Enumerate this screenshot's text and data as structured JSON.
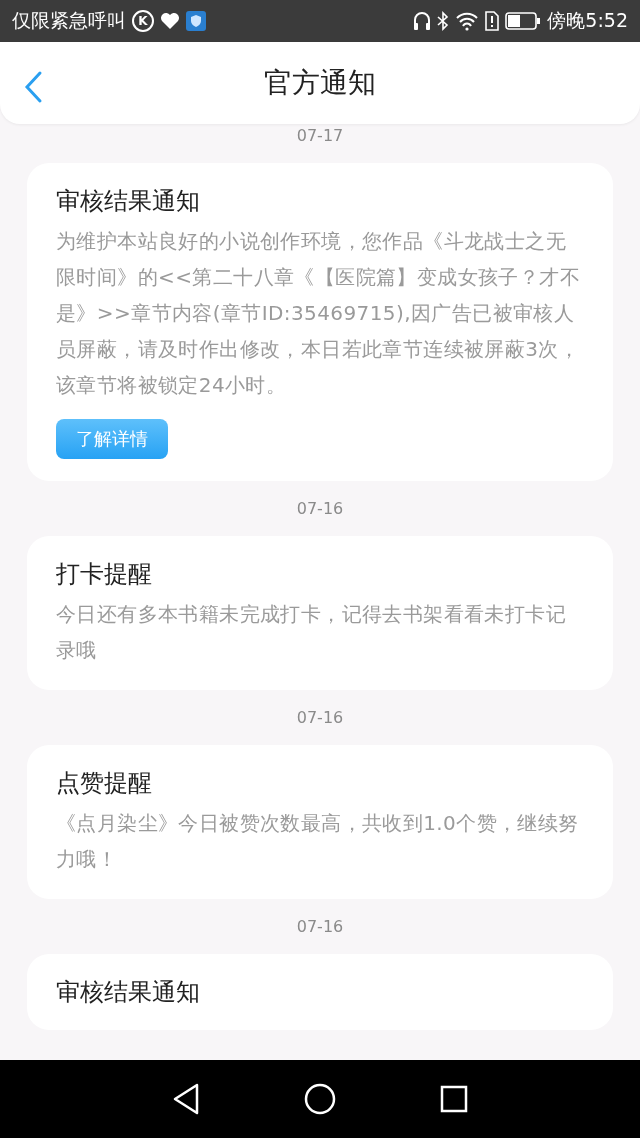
{
  "status_bar": {
    "carrier": "仅限紧急呼叫",
    "badge": "K",
    "time": "傍晚5:52"
  },
  "header": {
    "title": "官方通知"
  },
  "notifications": [
    {
      "date": "07-17",
      "title": "审核结果通知",
      "body": "为维护本站良好的小说创作环境，您作品《斗龙战士之无限时间》的<<第二十八章《【医院篇】变成女孩子？才不是》>>章节内容(章节ID:35469715),因广告已被审核人员屏蔽，请及时作出修改，本日若此章节连续被屏蔽3次，该章节将被锁定24小时。",
      "button": "了解详情"
    },
    {
      "date": "07-16",
      "title": "打卡提醒",
      "body": "今日还有多本书籍未完成打卡，记得去书架看看未打卡记录哦"
    },
    {
      "date": "07-16",
      "title": "点赞提醒",
      "body": "《点月染尘》今日被赞次数最高，共收到1.0个赞，继续努力哦！"
    },
    {
      "date": "07-16",
      "title": "审核结果通知"
    }
  ]
}
